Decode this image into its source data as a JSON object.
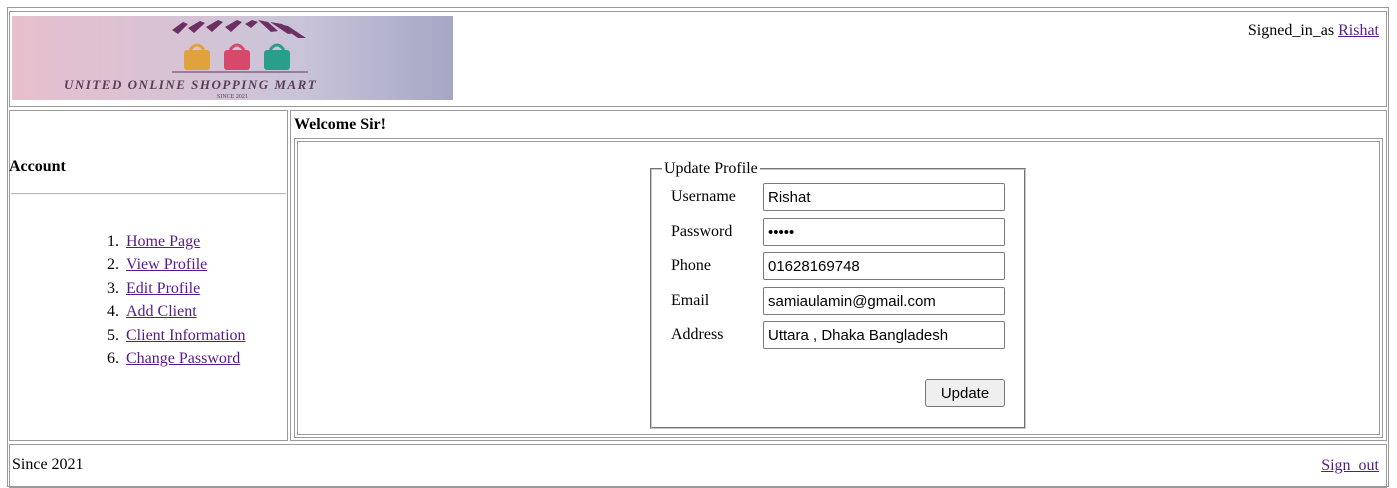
{
  "header": {
    "logo_text": "UNITED ONLINE SHOPPING MART",
    "logo_subtext": "SINCE 2021",
    "signed_in_prefix": "Signed_in_as",
    "signed_in_user": "Rishat"
  },
  "sidebar": {
    "title": "Account",
    "items": [
      {
        "num": "1.",
        "label": "Home Page"
      },
      {
        "num": "2.",
        "label": "View Profile"
      },
      {
        "num": "3.",
        "label": "Edit Profile"
      },
      {
        "num": "4.",
        "label": "Add Client"
      },
      {
        "num": "5.",
        "label": "Client Information"
      },
      {
        "num": "6.",
        "label": "Change Password"
      }
    ]
  },
  "main": {
    "welcome": "Welcome Sir!",
    "form": {
      "legend": "Update Profile",
      "username_label": "Username",
      "username_value": "Rishat",
      "password_label": "Password",
      "password_value": "•••••",
      "phone_label": "Phone",
      "phone_value": "01628169748",
      "email_label": "Email",
      "email_value": "samiaulamin@gmail.com",
      "address_label": "Address",
      "address_value": "Uttara , Dhaka Bangladesh",
      "submit_label": "Update"
    }
  },
  "footer": {
    "since": "Since 2021",
    "sign_out": "Sign_out"
  }
}
